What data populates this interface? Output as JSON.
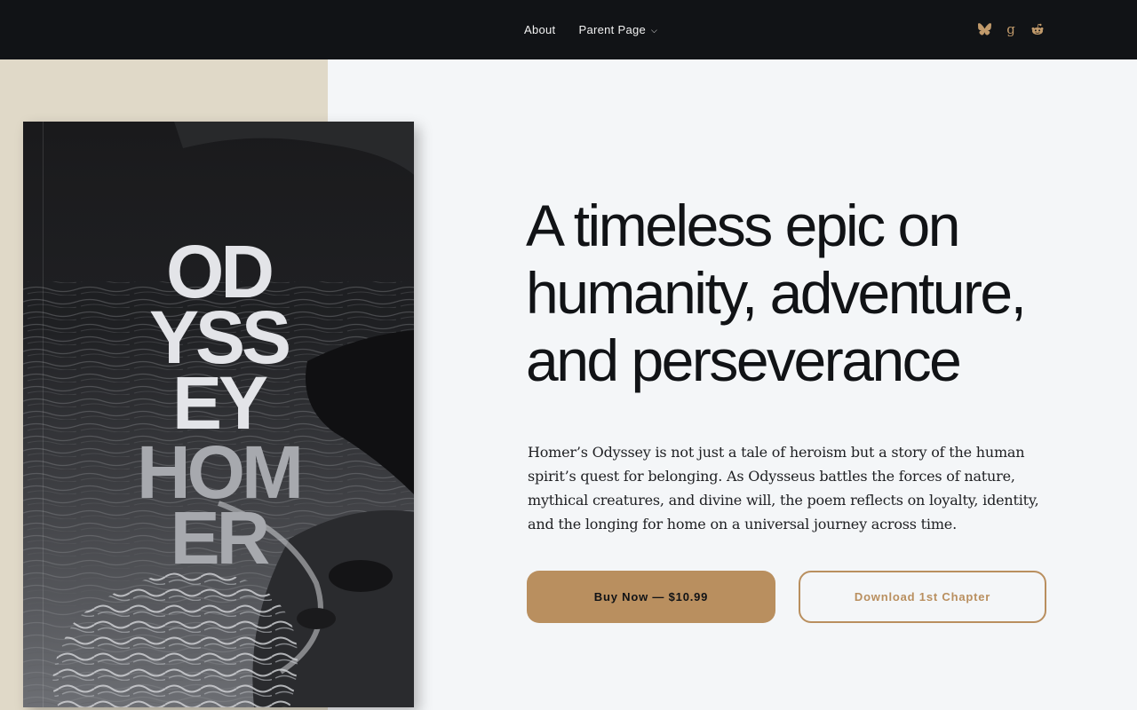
{
  "nav": {
    "items": [
      {
        "label": "About"
      },
      {
        "label": "Parent Page",
        "chevron": "⌵"
      }
    ]
  },
  "social": {
    "icons": [
      "bluesky-icon",
      "goodreads-icon",
      "reddit-icon"
    ],
    "goodreads_glyph": "g",
    "accent": "#c19a6b"
  },
  "book": {
    "title_lines": [
      "OD",
      "YSS",
      "EY"
    ],
    "author_lines": [
      "HOM",
      "ER"
    ]
  },
  "hero": {
    "headline_lines": [
      "A timeless epic on",
      "humanity, adventure,",
      "and perseverance"
    ],
    "description": "Homer’s Odyssey is not just a tale of heroism but a story of the human spirit’s quest for belonging. As Odysseus battles the forces of nature, mythical creatures, and divine will, the poem reflects on loyalty, identity, and the longing for home on a universal journey across time."
  },
  "buttons": {
    "buy": "Buy Now — $10.99",
    "download": "Download 1st Chapter"
  },
  "colors": {
    "topbar": "#111316",
    "accent": "#b98f5f",
    "left_panel": "#e0d9c8",
    "page_bg": "#f4f6f8"
  }
}
